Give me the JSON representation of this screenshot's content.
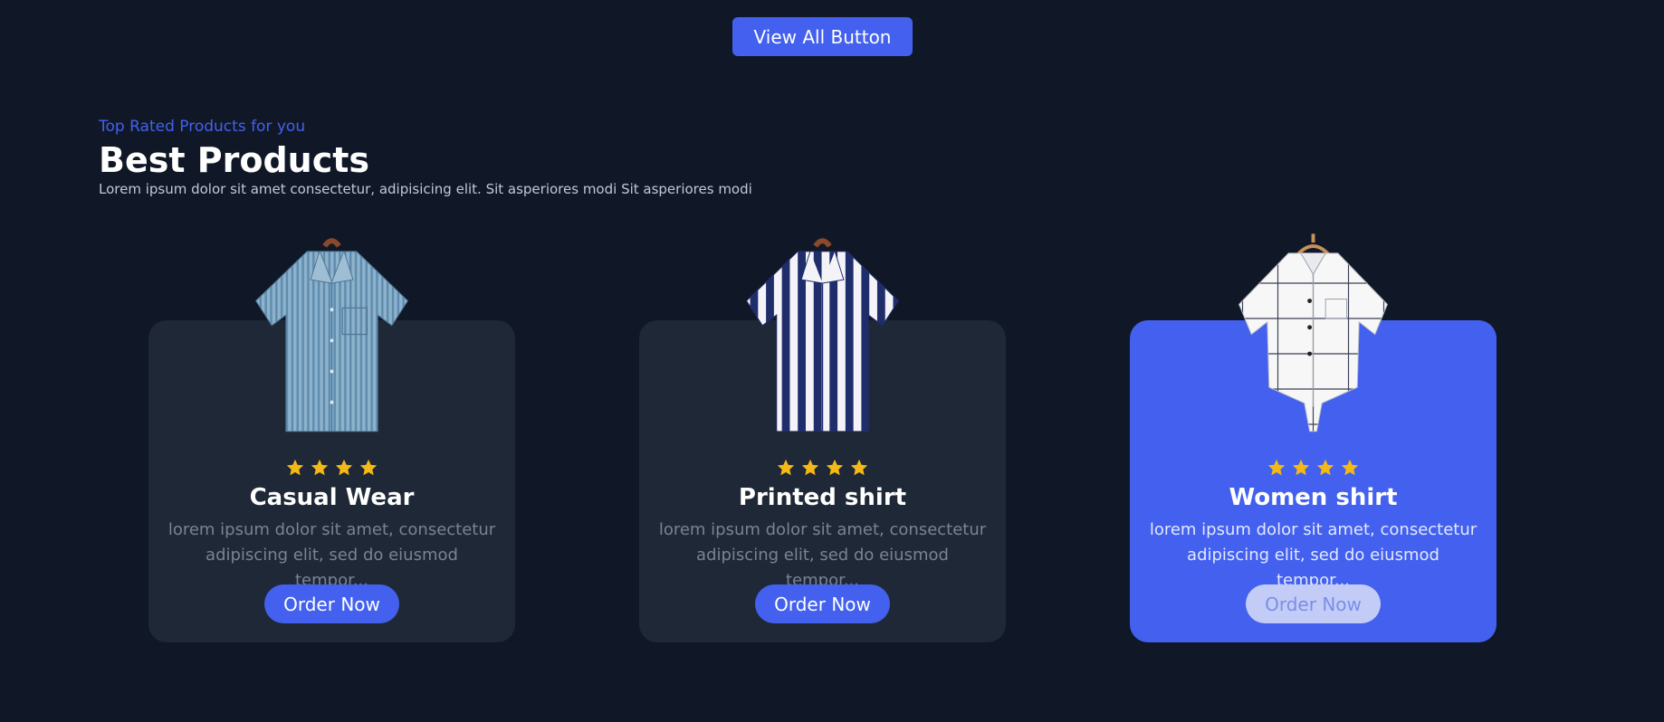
{
  "header": {
    "view_all_label": "View All Button"
  },
  "section": {
    "subtitle": "Top Rated Products for you",
    "title": "Best Products",
    "description": "Lorem ipsum dolor sit amet consectetur, adipisicing elit. Sit asperiores modi Sit asperiores modi"
  },
  "products": [
    {
      "name": "Casual Wear",
      "rating": 4,
      "description": "lorem ipsum dolor sit amet, consectetur adipiscing elit, sed do eiusmod tempor...",
      "button_label": "Order Now",
      "image": "blue-striped-shirt"
    },
    {
      "name": "Printed shirt",
      "rating": 4,
      "description": "lorem ipsum dolor sit amet, consectetur adipiscing elit, sed do eiusmod tempor...",
      "button_label": "Order Now",
      "image": "navy-striped-shirt"
    },
    {
      "name": "Women shirt",
      "rating": 4,
      "description": "lorem ipsum dolor sit amet, consectetur adipiscing elit, sed do eiusmod tempor...",
      "button_label": "Order Now",
      "image": "white-plaid-shirt"
    }
  ],
  "colors": {
    "accent": "#4361ee",
    "background": "#101828",
    "card": "#1e2837",
    "star": "#f5b915"
  }
}
